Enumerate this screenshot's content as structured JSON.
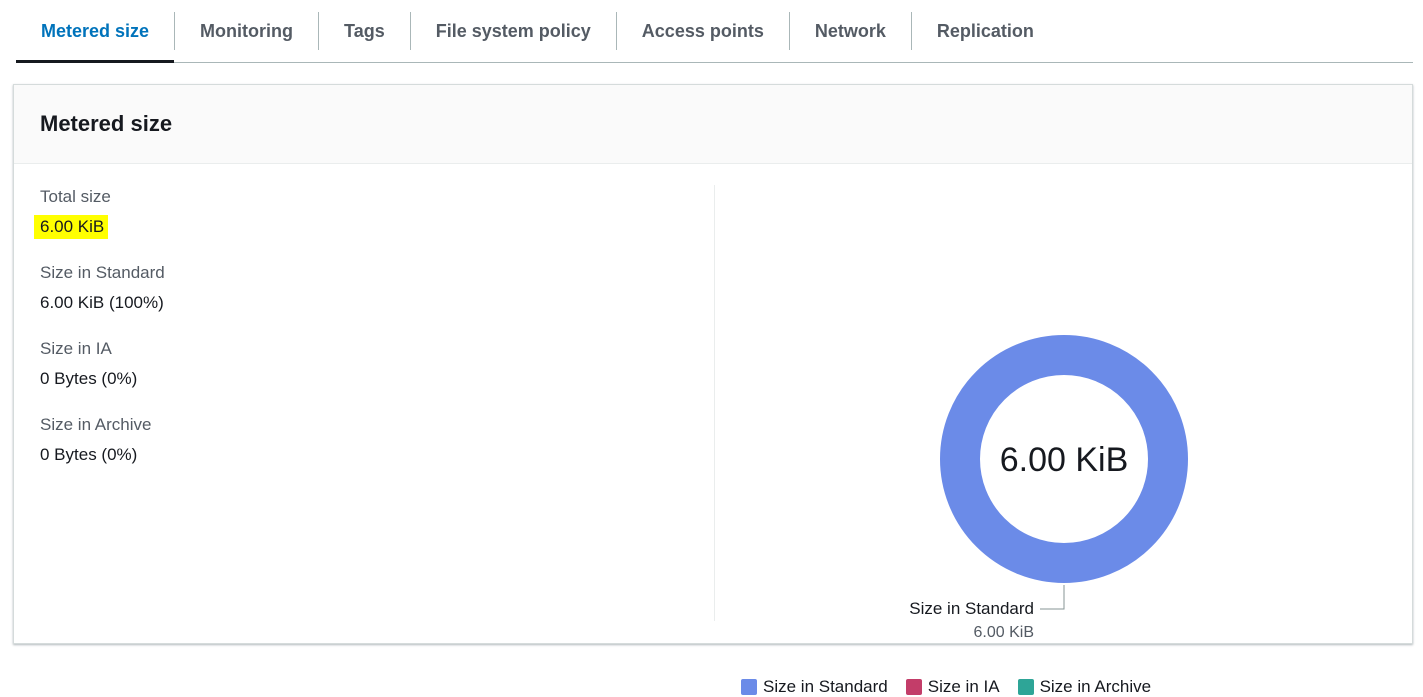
{
  "tabs": [
    {
      "label": "Metered size",
      "active": true
    },
    {
      "label": "Monitoring",
      "active": false
    },
    {
      "label": "Tags",
      "active": false
    },
    {
      "label": "File system policy",
      "active": false
    },
    {
      "label": "Access points",
      "active": false
    },
    {
      "label": "Network",
      "active": false
    },
    {
      "label": "Replication",
      "active": false
    }
  ],
  "panel": {
    "title": "Metered size",
    "stats": [
      {
        "label": "Total size",
        "value": "6.00 KiB",
        "highlighted": true
      },
      {
        "label": "Size in Standard",
        "value": "6.00 KiB (100%)"
      },
      {
        "label": "Size in IA",
        "value": "0 Bytes (0%)"
      },
      {
        "label": "Size in Archive",
        "value": "0 Bytes (0%)"
      }
    ]
  },
  "colors": {
    "standard": "#6b8be8",
    "ia": "#c33d69",
    "archive": "#2ea597",
    "active_tab": "#0073bb",
    "highlight": "#ffff00"
  },
  "chart_data": {
    "type": "pie",
    "donut": true,
    "center_label": "6.00 KiB",
    "categories": [
      "Size in Standard",
      "Size in IA",
      "Size in Archive"
    ],
    "values": [
      6.0,
      0,
      0
    ],
    "unit": "KiB",
    "slice_labels": [
      {
        "name": "Size in Standard",
        "value": "6.00 KiB"
      }
    ],
    "legend": [
      "Size in Standard",
      "Size in IA",
      "Size in Archive"
    ],
    "legend_position": "bottom"
  }
}
